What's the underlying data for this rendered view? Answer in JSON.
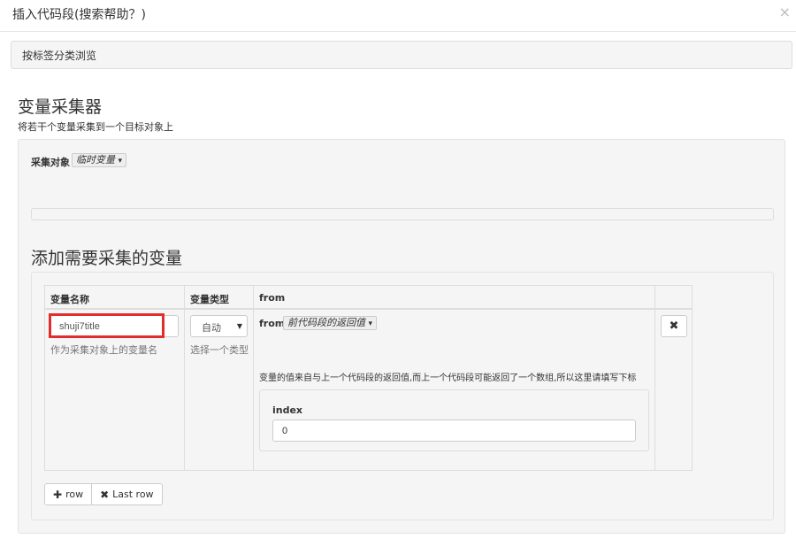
{
  "modal": {
    "title": "插入代码段(搜索帮助？)",
    "close_icon": "×"
  },
  "tag_panel": {
    "label": "按标签分类浏览"
  },
  "collector": {
    "title": "变量采集器",
    "description": "将若干个变量采集到一个目标对象上",
    "target_label": "采集对象",
    "target_value": "临时变量",
    "caret": "▾"
  },
  "variables": {
    "title": "添加需要采集的变量",
    "columns": [
      "变量名称",
      "变量类型",
      "from",
      ""
    ],
    "row": {
      "name_value": "shuji7title",
      "name_help": "作为采集对象上的变量名",
      "type_value": "自动",
      "type_help": "选择一个类型",
      "from_label": "from",
      "from_value": "前代码段的返回值",
      "from_description": "变量的值来自与上一个代码段的返回值,而上一个代码段可能返回了一个数组,所以这里请填写下标",
      "index_label": "index",
      "index_value": "0",
      "delete_icon": "✖"
    },
    "buttons": {
      "add_row_icon": "✚",
      "add_row_label": "row",
      "last_row_icon": "✖",
      "last_row_label": "Last row"
    }
  }
}
